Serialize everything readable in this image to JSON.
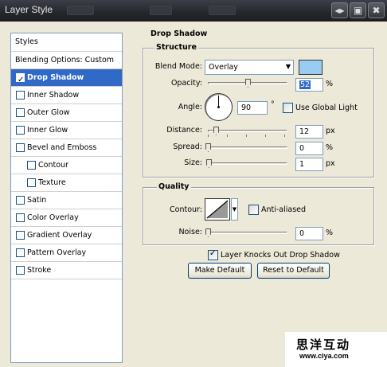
{
  "window": {
    "title": "Layer Style",
    "win_icon_a": "◂▸",
    "win_icon_b": "✖",
    "win_icon_c": "▣"
  },
  "style_list": {
    "header": "Styles",
    "items": [
      {
        "label": "Blending Options: Custom",
        "has_checkbox": false
      },
      {
        "label": "Drop Shadow",
        "has_checkbox": true,
        "checked": true,
        "selected": true
      },
      {
        "label": "Inner Shadow",
        "has_checkbox": true,
        "checked": false
      },
      {
        "label": "Outer Glow",
        "has_checkbox": true,
        "checked": false
      },
      {
        "label": "Inner Glow",
        "has_checkbox": true,
        "checked": false
      },
      {
        "label": "Bevel and Emboss",
        "has_checkbox": true,
        "checked": false
      },
      {
        "label": "Contour",
        "has_checkbox": true,
        "checked": false,
        "indent": true
      },
      {
        "label": "Texture",
        "has_checkbox": true,
        "checked": false,
        "indent": true
      },
      {
        "label": "Satin",
        "has_checkbox": true,
        "checked": false
      },
      {
        "label": "Color Overlay",
        "has_checkbox": true,
        "checked": false
      },
      {
        "label": "Gradient Overlay",
        "has_checkbox": true,
        "checked": false
      },
      {
        "label": "Pattern Overlay",
        "has_checkbox": true,
        "checked": false
      },
      {
        "label": "Stroke",
        "has_checkbox": true,
        "checked": false
      }
    ]
  },
  "drop_shadow": {
    "title": "Drop Shadow",
    "structure": {
      "title": "Structure",
      "blend_mode_label": "Blend Mode:",
      "blend_mode_value": "Overlay",
      "blend_color": "#99ccf2",
      "opacity_label": "Opacity:",
      "opacity_value": "52",
      "opacity_unit": "%",
      "opacity_fraction": 0.52,
      "angle_label": "Angle:",
      "angle_value": "90",
      "angle_unit": "°",
      "use_global_light_label": "Use Global Light",
      "use_global_light": false,
      "distance_label": "Distance:",
      "distance_value": "12",
      "distance_unit": "px",
      "spread_label": "Spread:",
      "spread_value": "0",
      "spread_unit": "%",
      "size_label": "Size:",
      "size_value": "1",
      "size_unit": "px"
    },
    "quality": {
      "title": "Quality",
      "contour_label": "Contour:",
      "anti_aliased_label": "Anti-aliased",
      "anti_aliased": false,
      "noise_label": "Noise:",
      "noise_value": "0",
      "noise_unit": "%"
    },
    "knocks_out_label": "Layer Knocks Out Drop Shadow",
    "knocks_out": true,
    "make_default_label": "Make Default",
    "reset_default_label": "Reset to Default"
  },
  "watermark": {
    "main": "思洋互动",
    "url": "www.ciya.com"
  },
  "colors": {
    "selection": "#3169c6",
    "dialog_bg": "#ece9d8",
    "titlebar": "#2a2c31"
  }
}
